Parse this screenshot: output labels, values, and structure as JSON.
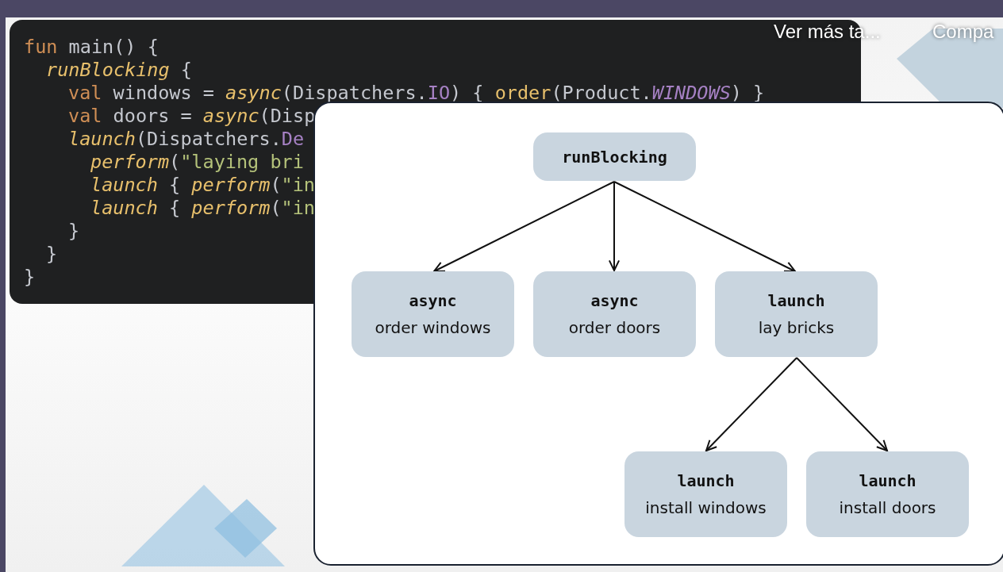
{
  "video_overlay": {
    "more_videos": "Ver más ta...",
    "share": "Compa"
  },
  "code": [
    {
      "tokens": [
        {
          "kind": "keyword",
          "text": "fun"
        },
        {
          "kind": "plain",
          "text": " main() {"
        }
      ],
      "children": [
        {
          "tokens": [
            {
              "kind": "call",
              "text": "runBlocking"
            },
            {
              "kind": "plain",
              "text": " {"
            }
          ],
          "children": [
            {
              "tokens": [
                {
                  "kind": "keyword",
                  "text": "val"
                },
                {
                  "kind": "plain",
                  "text": " windows = "
                },
                {
                  "kind": "call",
                  "text": "async"
                },
                {
                  "kind": "plain",
                  "text": "(Dispatchers."
                },
                {
                  "kind": "constant",
                  "text": "IO"
                },
                {
                  "kind": "plain",
                  "text": ") { "
                },
                {
                  "kind": "call_plain",
                  "text": "order"
                },
                {
                  "kind": "plain",
                  "text": "(Product."
                },
                {
                  "kind": "enum",
                  "text": "WINDOWS"
                },
                {
                  "kind": "plain",
                  "text": ") }"
                }
              ]
            },
            {
              "tokens": [
                {
                  "kind": "keyword",
                  "text": "val"
                },
                {
                  "kind": "plain",
                  "text": " doors = "
                },
                {
                  "kind": "call",
                  "text": "async"
                },
                {
                  "kind": "plain",
                  "text": "(Disp"
                }
              ]
            },
            {
              "tokens": [
                {
                  "kind": "call",
                  "text": "launch"
                },
                {
                  "kind": "plain",
                  "text": "(Dispatchers."
                },
                {
                  "kind": "constant",
                  "text": "De"
                }
              ],
              "children": [
                {
                  "tokens": [
                    {
                      "kind": "call",
                      "text": "perform"
                    },
                    {
                      "kind": "plain",
                      "text": "("
                    },
                    {
                      "kind": "string",
                      "text": "\"laying bri"
                    }
                  ]
                },
                {
                  "tokens": [
                    {
                      "kind": "call",
                      "text": "launch"
                    },
                    {
                      "kind": "plain",
                      "text": " { "
                    },
                    {
                      "kind": "call",
                      "text": "perform"
                    },
                    {
                      "kind": "plain",
                      "text": "("
                    },
                    {
                      "kind": "string",
                      "text": "\"in"
                    }
                  ]
                },
                {
                  "tokens": [
                    {
                      "kind": "call",
                      "text": "launch"
                    },
                    {
                      "kind": "plain",
                      "text": " { "
                    },
                    {
                      "kind": "call",
                      "text": "perform"
                    },
                    {
                      "kind": "plain",
                      "text": "("
                    },
                    {
                      "kind": "string",
                      "text": "\"in"
                    }
                  ]
                }
              ]
            },
            {
              "tokens": [
                {
                  "kind": "plain",
                  "text": "}"
                }
              ]
            }
          ]
        },
        {
          "tokens": [
            {
              "kind": "plain",
              "text": "}"
            }
          ]
        }
      ]
    },
    {
      "tokens": [
        {
          "kind": "plain",
          "text": "}"
        }
      ]
    }
  ],
  "diagram": {
    "root": {
      "title": "runBlocking",
      "children": [
        {
          "title": "async",
          "subtitle": "order windows"
        },
        {
          "title": "async",
          "subtitle": "order doors"
        },
        {
          "title": "launch",
          "subtitle": "lay bricks",
          "children": [
            {
              "title": "launch",
              "subtitle": "install windows"
            },
            {
              "title": "launch",
              "subtitle": "install doors"
            }
          ]
        }
      ]
    }
  }
}
